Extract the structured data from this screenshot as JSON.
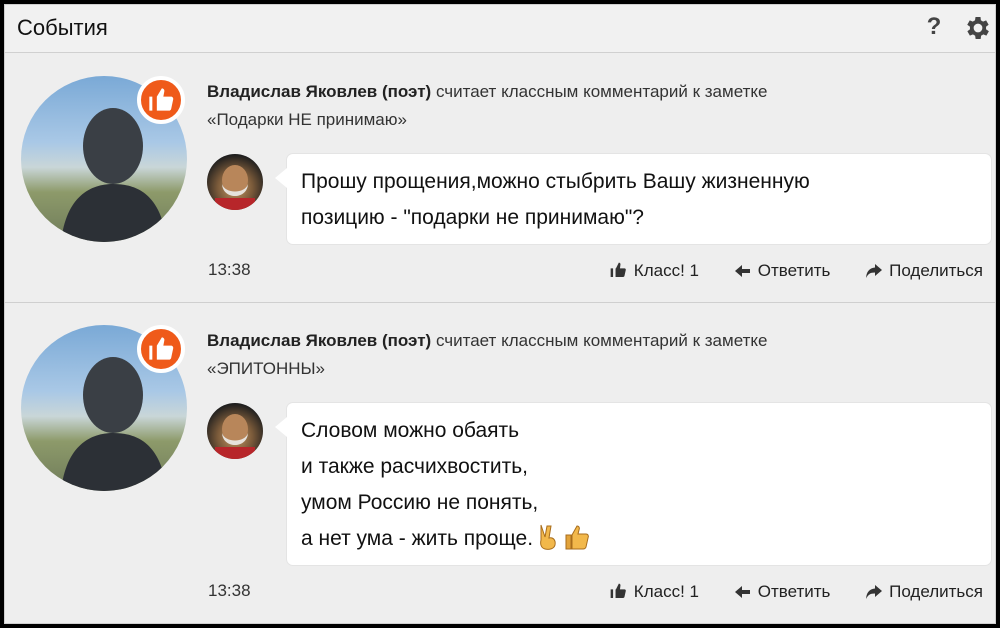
{
  "header": {
    "title": "События",
    "help_label": "?"
  },
  "events": [
    {
      "author": "Владислав Яковлев (поэт)",
      "action_text": "считает классным комментарий к заметке",
      "note_title": "«Подарки НЕ принимаю»",
      "comment_lines": [
        "Прошу прощения,можно стыбрить Вашу жизненную",
        "позицию - \"подарки не принимаю\"?"
      ],
      "time": "13:38",
      "like_label": "Класс! 1",
      "reply_label": "Ответить",
      "share_label": "Поделиться"
    },
    {
      "author": "Владислав Яковлев (поэт)",
      "action_text": "считает классным комментарий к заметке",
      "note_title": "«ЭПИТОННЫ»",
      "comment_lines": [
        "Словом можно обаять",
        "и также расчихвостить,",
        "умом Россию не понять,",
        "а нет ума - жить проще."
      ],
      "comment_emojis": [
        "victory-hand-icon",
        "thumbs-up-icon"
      ],
      "time": "13:38",
      "like_label": "Класс! 1",
      "reply_label": "Ответить",
      "share_label": "Поделиться"
    }
  ],
  "colors": {
    "like_badge": "#ef5a1a",
    "background": "#eeeeee",
    "bubble": "#ffffff"
  }
}
